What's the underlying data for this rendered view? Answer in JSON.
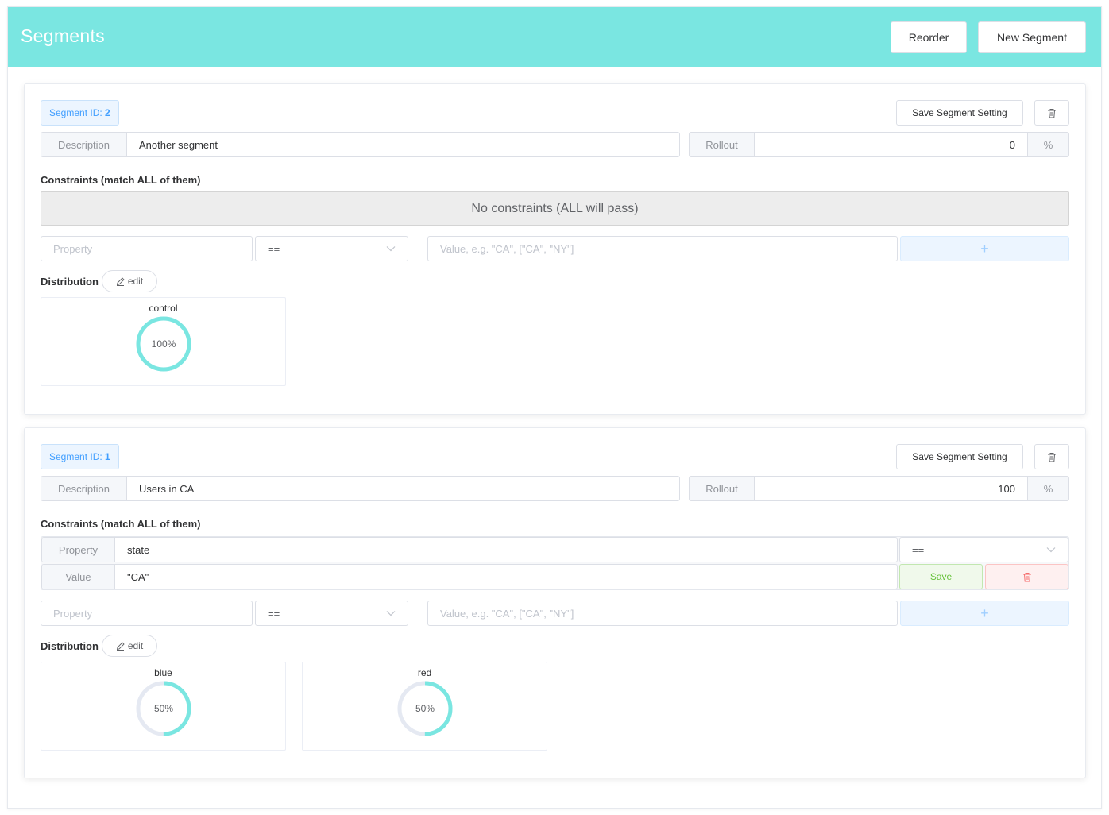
{
  "header": {
    "title": "Segments",
    "reorder_label": "Reorder",
    "new_segment_label": "New Segment"
  },
  "segments": [
    {
      "id_label": "Segment ID:",
      "id": "2",
      "save_label": "Save Segment Setting",
      "description_label": "Description",
      "description": "Another segment",
      "rollout_label": "Rollout",
      "rollout": "0",
      "rollout_unit": "%",
      "constraints_heading": "Constraints (match ALL of them)",
      "no_constraints_text": "No constraints (ALL will pass)",
      "constraints": [],
      "new_constraint": {
        "property_placeholder": "Property",
        "operator": "==",
        "value_placeholder": "Value, e.g. \"CA\", [\"CA\", \"NY\"]",
        "add_label": "+"
      },
      "distribution_label": "Distribution",
      "edit_label": "edit",
      "distributions": [
        {
          "variant": "control",
          "percent_label": "100%",
          "percent": 100
        }
      ]
    },
    {
      "id_label": "Segment ID:",
      "id": "1",
      "save_label": "Save Segment Setting",
      "description_label": "Description",
      "description": "Users in CA",
      "rollout_label": "Rollout",
      "rollout": "100",
      "rollout_unit": "%",
      "constraints_heading": "Constraints (match ALL of them)",
      "constraints": [
        {
          "property_label": "Property",
          "property": "state",
          "operator": "==",
          "value_label": "Value",
          "value": "\"CA\"",
          "save_label": "Save"
        }
      ],
      "new_constraint": {
        "property_placeholder": "Property",
        "operator": "==",
        "value_placeholder": "Value, e.g. \"CA\", [\"CA\", \"NY\"]",
        "add_label": "+"
      },
      "distribution_label": "Distribution",
      "edit_label": "edit",
      "distributions": [
        {
          "variant": "blue",
          "percent_label": "50%",
          "percent": 50
        },
        {
          "variant": "red",
          "percent_label": "50%",
          "percent": 50
        }
      ]
    }
  ],
  "colors": {
    "header_bg": "#7ae6e1",
    "donut_fill": "#7ae6e1",
    "donut_track": "#e5e9f2",
    "primary": "#409eff",
    "success": "#67c23a",
    "danger": "#f56c6c"
  },
  "icons": {
    "delete": "trash-icon",
    "edit": "pencil-icon",
    "select": "chevron-down-icon"
  }
}
